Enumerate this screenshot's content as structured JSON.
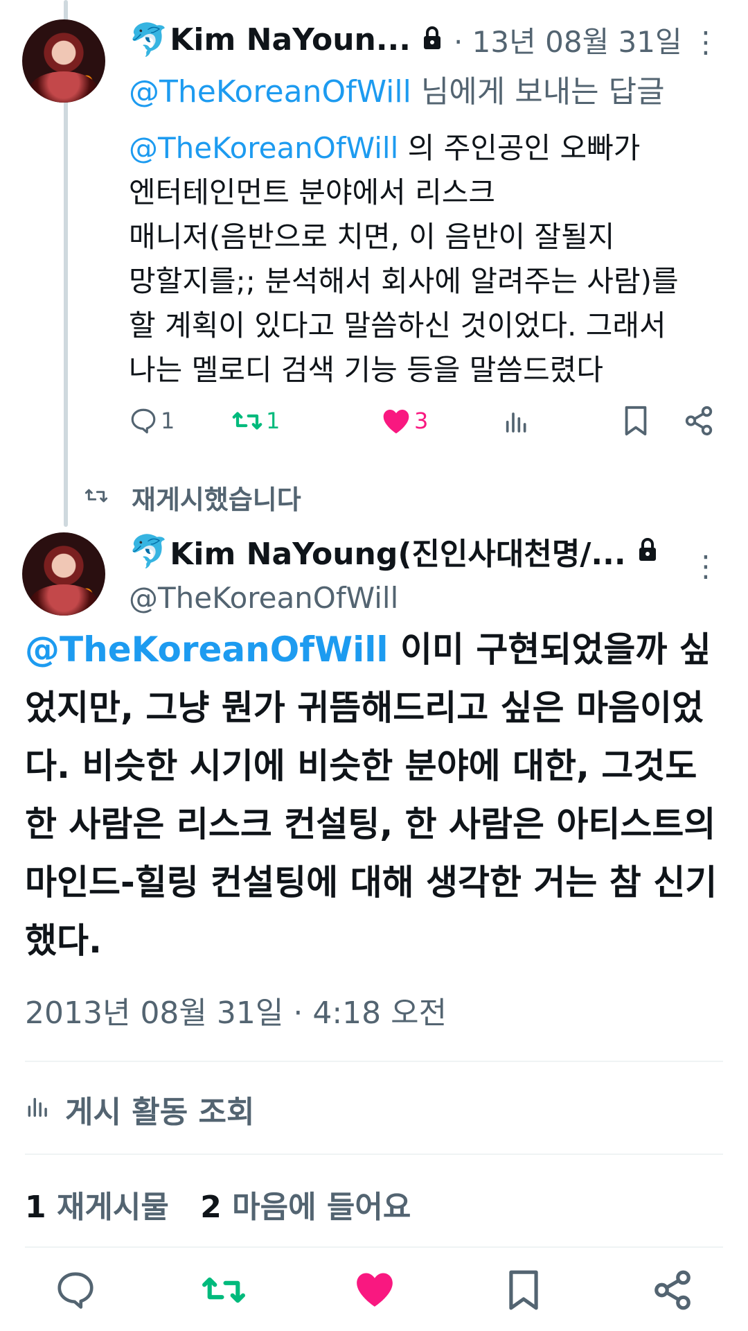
{
  "reply": {
    "emoji": "🐬",
    "display_name": "Kim NaYoun...",
    "date": "· 13년 08월 31일",
    "replying_to_handle": "@TheKoreanOfWill",
    "replying_to_suffix": " 님에게 보내는 답글",
    "body_mention": "@TheKoreanOfWill",
    "body_text": " 의 주인공인 오빠가\n엔터테인먼트 분야에서 리스크\n매니저(음반으로 치면, 이 음반이 잘될지\n망할지를;; 분석해서 회사에 알려주는 사람)를\n할 계획이 있다고 말씀하신 것이었다. 그래서\n나는 멜로디 검색 기능 등을 말씀드렸다",
    "reply_count": "1",
    "repost_count": "1",
    "like_count": "3"
  },
  "repost_banner": {
    "label": "재게시했습니다"
  },
  "main_post": {
    "emoji": "🐬",
    "display_name": "Kim NaYoung(진인사대천명/...",
    "handle": "@TheKoreanOfWill",
    "body_mention": "@TheKoreanOfWill",
    "body_text": " 이미 구현되었을까 싶었지만, 그냥 뭔가 귀뜸해드리고 싶은 마음이었다. 비슷한 시기에 비슷한 분야에 대한, 그것도 한 사람은 리스크 컨설팅, 한 사람은 아티스트의 마인드-힐링 컨설팅에 대해 생각한 거는 참 신기했다.",
    "timestamp": "2013년 08월 31일 · 4:18 오전",
    "activity_label": "게시 활동 조회",
    "repost_count": "1",
    "repost_label": " 재게시물",
    "like_count": "2",
    "like_label": " 마음에 들어요"
  },
  "colors": {
    "accent": "#1d9bf0",
    "repost_green": "#00ba7c",
    "like_pink": "#f91880",
    "secondary_text": "#536471"
  }
}
